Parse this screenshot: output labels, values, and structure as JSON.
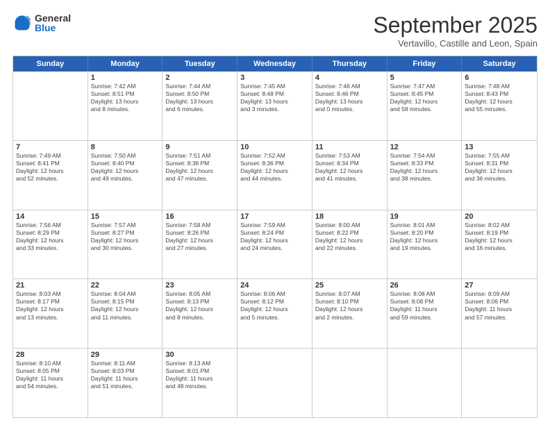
{
  "logo": {
    "line1": "General",
    "line2": "Blue"
  },
  "title": "September 2025",
  "subtitle": "Vertavillo, Castille and Leon, Spain",
  "headers": [
    "Sunday",
    "Monday",
    "Tuesday",
    "Wednesday",
    "Thursday",
    "Friday",
    "Saturday"
  ],
  "weeks": [
    [
      {
        "day": "",
        "info": ""
      },
      {
        "day": "1",
        "info": "Sunrise: 7:42 AM\nSunset: 8:51 PM\nDaylight: 13 hours\nand 8 minutes."
      },
      {
        "day": "2",
        "info": "Sunrise: 7:44 AM\nSunset: 8:50 PM\nDaylight: 13 hours\nand 6 minutes."
      },
      {
        "day": "3",
        "info": "Sunrise: 7:45 AM\nSunset: 8:48 PM\nDaylight: 13 hours\nand 3 minutes."
      },
      {
        "day": "4",
        "info": "Sunrise: 7:46 AM\nSunset: 8:46 PM\nDaylight: 13 hours\nand 0 minutes."
      },
      {
        "day": "5",
        "info": "Sunrise: 7:47 AM\nSunset: 8:45 PM\nDaylight: 12 hours\nand 58 minutes."
      },
      {
        "day": "6",
        "info": "Sunrise: 7:48 AM\nSunset: 8:43 PM\nDaylight: 12 hours\nand 55 minutes."
      }
    ],
    [
      {
        "day": "7",
        "info": "Sunrise: 7:49 AM\nSunset: 8:41 PM\nDaylight: 12 hours\nand 52 minutes."
      },
      {
        "day": "8",
        "info": "Sunrise: 7:50 AM\nSunset: 8:40 PM\nDaylight: 12 hours\nand 49 minutes."
      },
      {
        "day": "9",
        "info": "Sunrise: 7:51 AM\nSunset: 8:38 PM\nDaylight: 12 hours\nand 47 minutes."
      },
      {
        "day": "10",
        "info": "Sunrise: 7:52 AM\nSunset: 8:36 PM\nDaylight: 12 hours\nand 44 minutes."
      },
      {
        "day": "11",
        "info": "Sunrise: 7:53 AM\nSunset: 8:34 PM\nDaylight: 12 hours\nand 41 minutes."
      },
      {
        "day": "12",
        "info": "Sunrise: 7:54 AM\nSunset: 8:33 PM\nDaylight: 12 hours\nand 38 minutes."
      },
      {
        "day": "13",
        "info": "Sunrise: 7:55 AM\nSunset: 8:31 PM\nDaylight: 12 hours\nand 36 minutes."
      }
    ],
    [
      {
        "day": "14",
        "info": "Sunrise: 7:56 AM\nSunset: 8:29 PM\nDaylight: 12 hours\nand 33 minutes."
      },
      {
        "day": "15",
        "info": "Sunrise: 7:57 AM\nSunset: 8:27 PM\nDaylight: 12 hours\nand 30 minutes."
      },
      {
        "day": "16",
        "info": "Sunrise: 7:58 AM\nSunset: 8:26 PM\nDaylight: 12 hours\nand 27 minutes."
      },
      {
        "day": "17",
        "info": "Sunrise: 7:59 AM\nSunset: 8:24 PM\nDaylight: 12 hours\nand 24 minutes."
      },
      {
        "day": "18",
        "info": "Sunrise: 8:00 AM\nSunset: 8:22 PM\nDaylight: 12 hours\nand 22 minutes."
      },
      {
        "day": "19",
        "info": "Sunrise: 8:01 AM\nSunset: 8:20 PM\nDaylight: 12 hours\nand 19 minutes."
      },
      {
        "day": "20",
        "info": "Sunrise: 8:02 AM\nSunset: 8:19 PM\nDaylight: 12 hours\nand 16 minutes."
      }
    ],
    [
      {
        "day": "21",
        "info": "Sunrise: 8:03 AM\nSunset: 8:17 PM\nDaylight: 12 hours\nand 13 minutes."
      },
      {
        "day": "22",
        "info": "Sunrise: 8:04 AM\nSunset: 8:15 PM\nDaylight: 12 hours\nand 11 minutes."
      },
      {
        "day": "23",
        "info": "Sunrise: 8:05 AM\nSunset: 8:13 PM\nDaylight: 12 hours\nand 8 minutes."
      },
      {
        "day": "24",
        "info": "Sunrise: 8:06 AM\nSunset: 8:12 PM\nDaylight: 12 hours\nand 5 minutes."
      },
      {
        "day": "25",
        "info": "Sunrise: 8:07 AM\nSunset: 8:10 PM\nDaylight: 12 hours\nand 2 minutes."
      },
      {
        "day": "26",
        "info": "Sunrise: 8:08 AM\nSunset: 8:08 PM\nDaylight: 11 hours\nand 59 minutes."
      },
      {
        "day": "27",
        "info": "Sunrise: 8:09 AM\nSunset: 8:06 PM\nDaylight: 11 hours\nand 57 minutes."
      }
    ],
    [
      {
        "day": "28",
        "info": "Sunrise: 8:10 AM\nSunset: 8:05 PM\nDaylight: 11 hours\nand 54 minutes."
      },
      {
        "day": "29",
        "info": "Sunrise: 8:11 AM\nSunset: 8:03 PM\nDaylight: 11 hours\nand 51 minutes."
      },
      {
        "day": "30",
        "info": "Sunrise: 8:13 AM\nSunset: 8:01 PM\nDaylight: 11 hours\nand 48 minutes."
      },
      {
        "day": "",
        "info": ""
      },
      {
        "day": "",
        "info": ""
      },
      {
        "day": "",
        "info": ""
      },
      {
        "day": "",
        "info": ""
      }
    ]
  ]
}
